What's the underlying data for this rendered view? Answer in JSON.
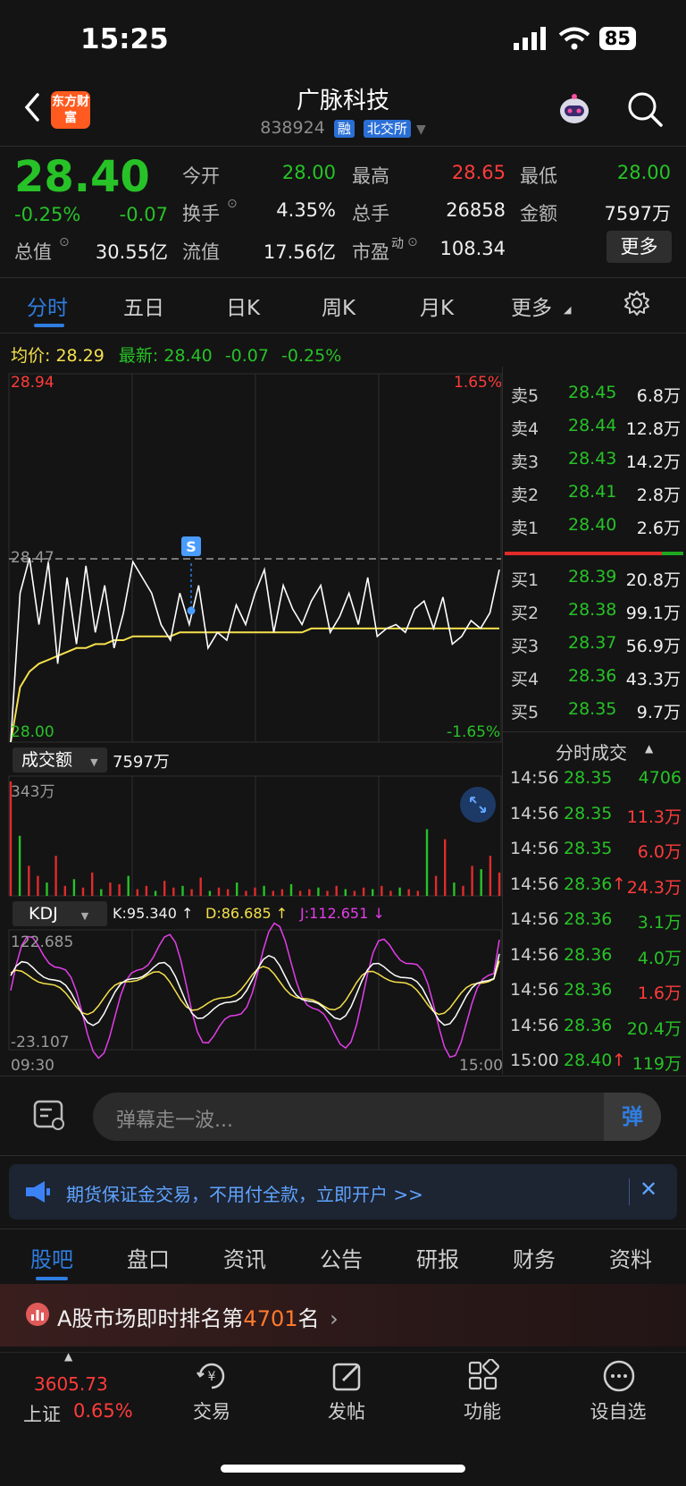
{
  "status_bar": {
    "time": "15:25",
    "battery": "85"
  },
  "header": {
    "logo_text": "东方财富",
    "title": "广脉科技",
    "code": "838924",
    "tag1": "融",
    "tag2": "北交所"
  },
  "quote": {
    "price": "28.40",
    "change_pct": "-0.25%",
    "change_abs": "-0.07",
    "fields": [
      {
        "label": "今开",
        "value": "28.00",
        "color": "green"
      },
      {
        "label": "最高",
        "value": "28.65",
        "color": "red"
      },
      {
        "label": "最低",
        "value": "28.00",
        "color": "green"
      },
      {
        "label": "换手",
        "value": "4.35%",
        "color": "white"
      },
      {
        "label": "总手",
        "value": "26858",
        "color": "white"
      },
      {
        "label": "金额",
        "value": "7597万",
        "color": "white"
      },
      {
        "label": "总值",
        "value": "30.55亿",
        "color": "white"
      },
      {
        "label": "流值",
        "value": "17.56亿",
        "color": "white"
      },
      {
        "label": "市盈",
        "label_sup": "动",
        "value": "108.34",
        "color": "white"
      }
    ],
    "more_label": "更多"
  },
  "chart_tabs": [
    "分时",
    "五日",
    "日K",
    "周K",
    "月K",
    "更多"
  ],
  "avg_bar": {
    "avg_label": "均价:",
    "avg_value": "28.29",
    "latest_label": "最新:",
    "latest_value": "28.40",
    "latest_change": "-0.07",
    "latest_pct": "-0.25%"
  },
  "intraday": {
    "y_high": "28.94",
    "y_high_pct": "1.65%",
    "y_mid": "28.47",
    "y_low": "28.00",
    "y_low_pct": "-1.65%",
    "marker": "S",
    "volume_selector": "成交额",
    "volume_total": "7597万",
    "volume_max": "343万",
    "kdj_selector": "KDJ",
    "kdj_k": "K:95.340 ↑",
    "kdj_d": "D:86.685 ↑",
    "kdj_j": "J:112.651 ↓",
    "kdj_high": "122.685",
    "kdj_low": "-23.107",
    "time_start": "09:30",
    "time_end": "15:00"
  },
  "chart_data": {
    "type": "line",
    "title": "",
    "xlabel": "",
    "ylabel": "",
    "ylim": [
      28.0,
      28.94
    ],
    "x_range": [
      "09:30",
      "15:00"
    ],
    "series": [
      {
        "name": "最新",
        "color": "#ffffff",
        "values": [
          28.0,
          28.38,
          28.47,
          28.3,
          28.46,
          28.2,
          28.42,
          28.25,
          28.45,
          28.28,
          28.4,
          28.24,
          28.33,
          28.46,
          28.42,
          28.38,
          28.3,
          28.26,
          28.38,
          28.3,
          28.4,
          28.24,
          28.28,
          28.26,
          28.35,
          28.3,
          28.38,
          28.44,
          28.28,
          28.4,
          28.34,
          28.3,
          28.36,
          28.4,
          28.28,
          28.32,
          28.38,
          28.3,
          28.42,
          28.27,
          28.29,
          28.3,
          28.28,
          28.34,
          28.36,
          28.29,
          28.37,
          28.25,
          28.27,
          28.31,
          28.29,
          28.33,
          28.44
        ]
      },
      {
        "name": "均价",
        "color": "#f5e04c",
        "values": [
          28.0,
          28.14,
          28.18,
          28.2,
          28.21,
          28.22,
          28.23,
          28.24,
          28.24,
          28.25,
          28.25,
          28.26,
          28.26,
          28.27,
          28.27,
          28.27,
          28.27,
          28.27,
          28.28,
          28.28,
          28.28,
          28.28,
          28.28,
          28.28,
          28.28,
          28.28,
          28.28,
          28.28,
          28.28,
          28.28,
          28.28,
          28.28,
          28.29,
          28.29,
          28.29,
          28.29,
          28.29,
          28.29,
          28.29,
          28.29,
          28.29,
          28.29,
          28.29,
          28.29,
          28.29,
          28.29,
          28.29,
          28.29,
          28.29,
          28.29,
          28.29,
          28.29,
          28.29
        ]
      }
    ],
    "volume": {
      "max": 343,
      "unit": "万",
      "values": [
        343,
        180,
        90,
        60,
        40,
        120,
        30,
        50,
        25,
        70,
        20,
        40,
        35,
        60,
        20,
        30,
        15,
        45,
        25,
        30,
        20,
        55,
        15,
        25,
        20,
        40,
        15,
        25,
        30,
        15,
        20,
        35,
        15,
        20,
        25,
        15,
        30,
        20,
        15,
        25,
        20,
        30,
        15,
        25,
        20,
        15,
        200,
        60,
        170,
        40,
        30,
        90,
        80,
        120,
        70
      ]
    },
    "kdj": {
      "ylim": [
        -23.107,
        122.685
      ],
      "k_last": 95.34,
      "d_last": 86.685,
      "j_last": 112.651
    }
  },
  "order_book": {
    "asks": [
      {
        "label": "卖5",
        "price": "28.45",
        "vol": "6.8万"
      },
      {
        "label": "卖4",
        "price": "28.44",
        "vol": "12.8万"
      },
      {
        "label": "卖3",
        "price": "28.43",
        "vol": "14.2万"
      },
      {
        "label": "卖2",
        "price": "28.41",
        "vol": "2.8万"
      },
      {
        "label": "卖1",
        "price": "28.40",
        "vol": "2.6万"
      }
    ],
    "bids": [
      {
        "label": "买1",
        "price": "28.39",
        "vol": "20.8万"
      },
      {
        "label": "买2",
        "price": "28.38",
        "vol": "99.1万"
      },
      {
        "label": "买3",
        "price": "28.37",
        "vol": "56.9万"
      },
      {
        "label": "买4",
        "price": "28.36",
        "vol": "43.3万"
      },
      {
        "label": "买5",
        "price": "28.35",
        "vol": "9.7万"
      }
    ]
  },
  "trades": {
    "title": "分时成交",
    "rows": [
      {
        "time": "14:56",
        "price": "28.35",
        "vol": "4706",
        "dir": "",
        "vcolor": "green"
      },
      {
        "time": "14:56",
        "price": "28.35",
        "vol": "11.3万",
        "dir": "",
        "vcolor": "red"
      },
      {
        "time": "14:56",
        "price": "28.35",
        "vol": "6.0万",
        "dir": "",
        "vcolor": "red"
      },
      {
        "time": "14:56",
        "price": "28.36",
        "vol": "24.3万",
        "dir": "↑",
        "vcolor": "red"
      },
      {
        "time": "14:56",
        "price": "28.36",
        "vol": "3.1万",
        "dir": "",
        "vcolor": "green"
      },
      {
        "time": "14:56",
        "price": "28.36",
        "vol": "4.0万",
        "dir": "",
        "vcolor": "green"
      },
      {
        "time": "14:56",
        "price": "28.36",
        "vol": "1.6万",
        "dir": "",
        "vcolor": "red"
      },
      {
        "time": "14:56",
        "price": "28.36",
        "vol": "20.4万",
        "dir": "",
        "vcolor": "green"
      },
      {
        "time": "15:00",
        "price": "28.40",
        "vol": "119万",
        "dir": "↑",
        "vcolor": "green"
      }
    ]
  },
  "danmu": {
    "placeholder": "弹幕走一波...",
    "button": "弹"
  },
  "ad": {
    "text": "期货保证金交易，不用付全款，立即开户 >>",
    "close": "✕"
  },
  "bottom_tabs": [
    "股吧",
    "盘口",
    "资讯",
    "公告",
    "研报",
    "财务",
    "资料"
  ],
  "rank": {
    "prefix": "A股市场即时排名第",
    "number": "4701",
    "suffix": "名"
  },
  "bottom_nav": {
    "index_value": "3605.73",
    "index_name": "上证",
    "index_pct": "0.65%",
    "items": [
      {
        "label": "交易",
        "icon": "trade-icon"
      },
      {
        "label": "发帖",
        "icon": "post-icon"
      },
      {
        "label": "功能",
        "icon": "apps-icon"
      },
      {
        "label": "设自选",
        "icon": "more-icon"
      }
    ]
  }
}
